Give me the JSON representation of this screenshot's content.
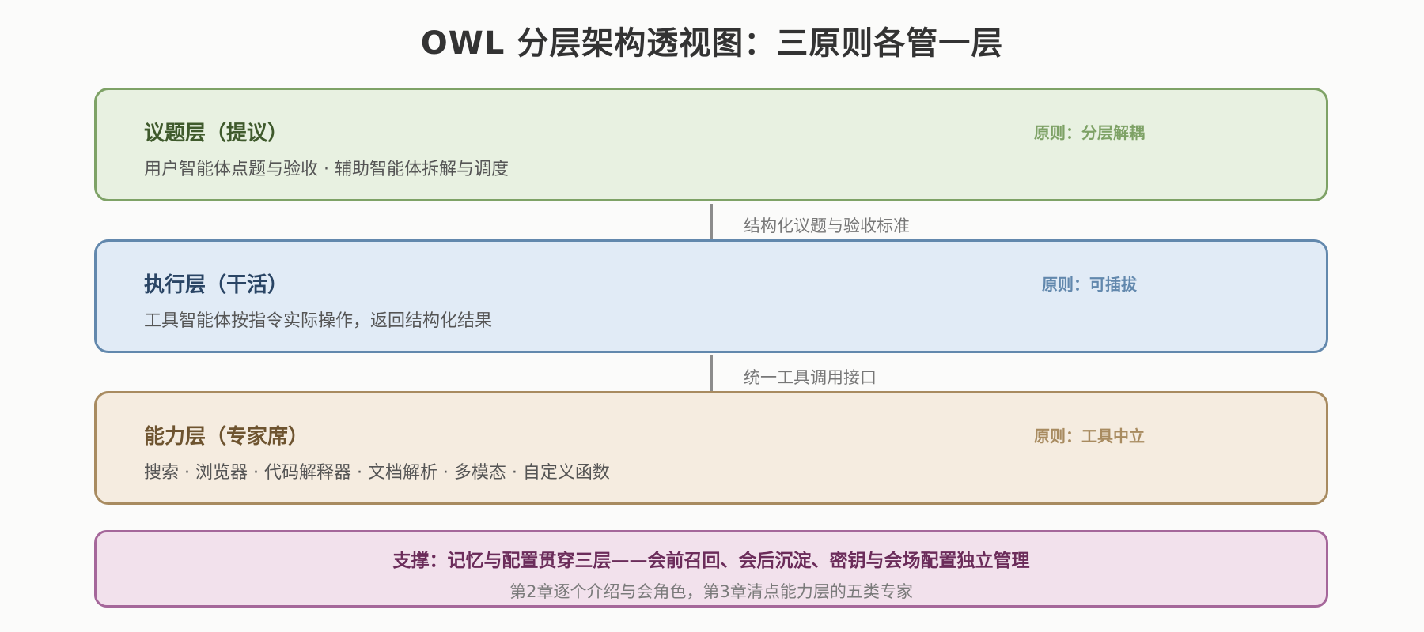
{
  "title": "OWL 分层架构透视图：三原则各管一层",
  "layers": [
    {
      "name": "议题层（提议）",
      "desc": "用户智能体点题与验收 · 辅助智能体拆解与调度",
      "principle": "原则：分层解耦",
      "color": "#7ea266"
    },
    {
      "name": "执行层（干活）",
      "desc": "工具智能体按指令实际操作，返回结构化结果",
      "principle": "原则：可插拔",
      "color": "#6288ad"
    },
    {
      "name": "能力层（专家席）",
      "desc": "搜索 · 浏览器 · 代码解释器 · 文档解析 · 多模态 · 自定义函数",
      "principle": "原则：工具中立",
      "color": "#a88b60"
    }
  ],
  "connectors": [
    {
      "label": "结构化议题与验收标准"
    },
    {
      "label": "统一工具调用接口"
    }
  ],
  "support": {
    "main": "支撑：记忆与配置贯穿三层——会前召回、会后沉淀、密钥与会场配置独立管理",
    "sub": "第2章逐个介绍与会角色，第3章清点能力层的五类专家",
    "color": "#a5679a"
  }
}
